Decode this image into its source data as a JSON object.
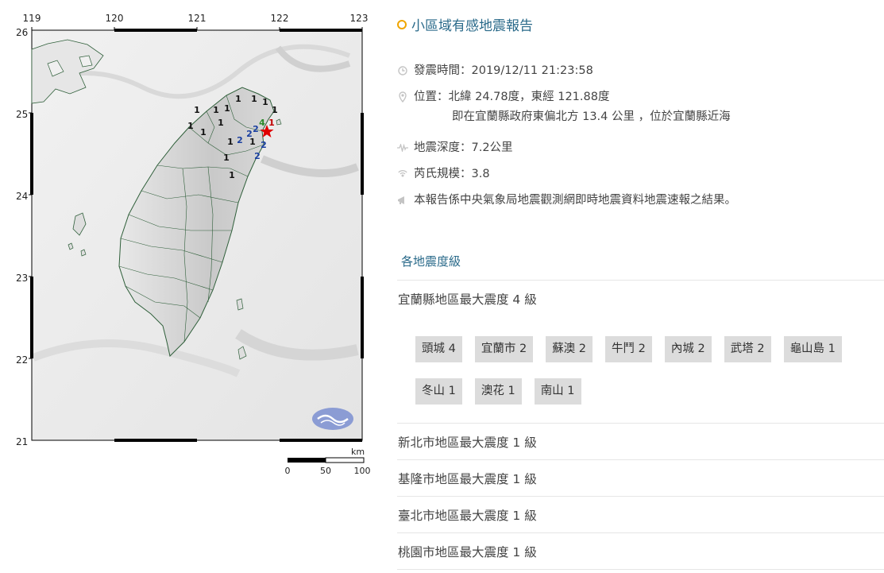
{
  "map": {
    "lon_ticks": [
      "119",
      "120",
      "121",
      "122",
      "123"
    ],
    "lat_ticks": [
      "26",
      "25",
      "24",
      "23",
      "22",
      "21"
    ],
    "scale": {
      "unit": "km",
      "labels": [
        "0",
        "50",
        "100"
      ]
    },
    "intensity_marks": [
      {
        "value": "1",
        "color": "#111"
      },
      {
        "value": "1",
        "color": "#111"
      },
      {
        "value": "1",
        "color": "#111"
      },
      {
        "value": "1",
        "color": "#111"
      },
      {
        "value": "1",
        "color": "#111"
      },
      {
        "value": "1",
        "color": "#111"
      },
      {
        "value": "1",
        "color": "#111"
      },
      {
        "value": "1",
        "color": "#111"
      },
      {
        "value": "1",
        "color": "#111"
      },
      {
        "value": "1",
        "color": "#111"
      },
      {
        "value": "1",
        "color": "#111"
      },
      {
        "value": "1",
        "color": "#111"
      },
      {
        "value": "1",
        "color": "#111"
      },
      {
        "value": "1",
        "color": "#111"
      },
      {
        "value": "2",
        "color": "#1a3fa0"
      },
      {
        "value": "2",
        "color": "#1a3fa0"
      },
      {
        "value": "2",
        "color": "#1a3fa0"
      },
      {
        "value": "2",
        "color": "#1a3fa0"
      },
      {
        "value": "2",
        "color": "#1a3fa0"
      },
      {
        "value": "4",
        "color": "#2b8a2b"
      },
      {
        "value": "1",
        "color": "#c00000"
      }
    ],
    "epicenter_color": "#e00000"
  },
  "report": {
    "title": "小區域有感地震報告",
    "time": "發震時間：2019/12/11 21:23:58",
    "location_line1": "位置：北緯 24.78度，東經 121.88度",
    "location_line2": "即在宜蘭縣政府東偏北方 13.4 公里 ，位於宜蘭縣近海",
    "depth": "地震深度：7.2公里",
    "magnitude": "芮氏規模：3.8",
    "note": "本報告係中央氣象局地震觀測網即時地震資料地震速報之結果。",
    "section_title": "各地震度級",
    "areas": [
      "宜蘭縣地區最大震度 4 級",
      "新北市地區最大震度 1 級",
      "基隆市地區最大震度 1 級",
      "臺北市地區最大震度 1 級",
      "桃園市地區最大震度 1 級"
    ],
    "stations": [
      "頭城 4",
      "宜蘭市 2",
      "蘇澳 2",
      "牛鬥 2",
      "內城 2",
      "武塔 2",
      "龜山島 1",
      "冬山 1",
      "澳花 1",
      "南山 1"
    ]
  }
}
